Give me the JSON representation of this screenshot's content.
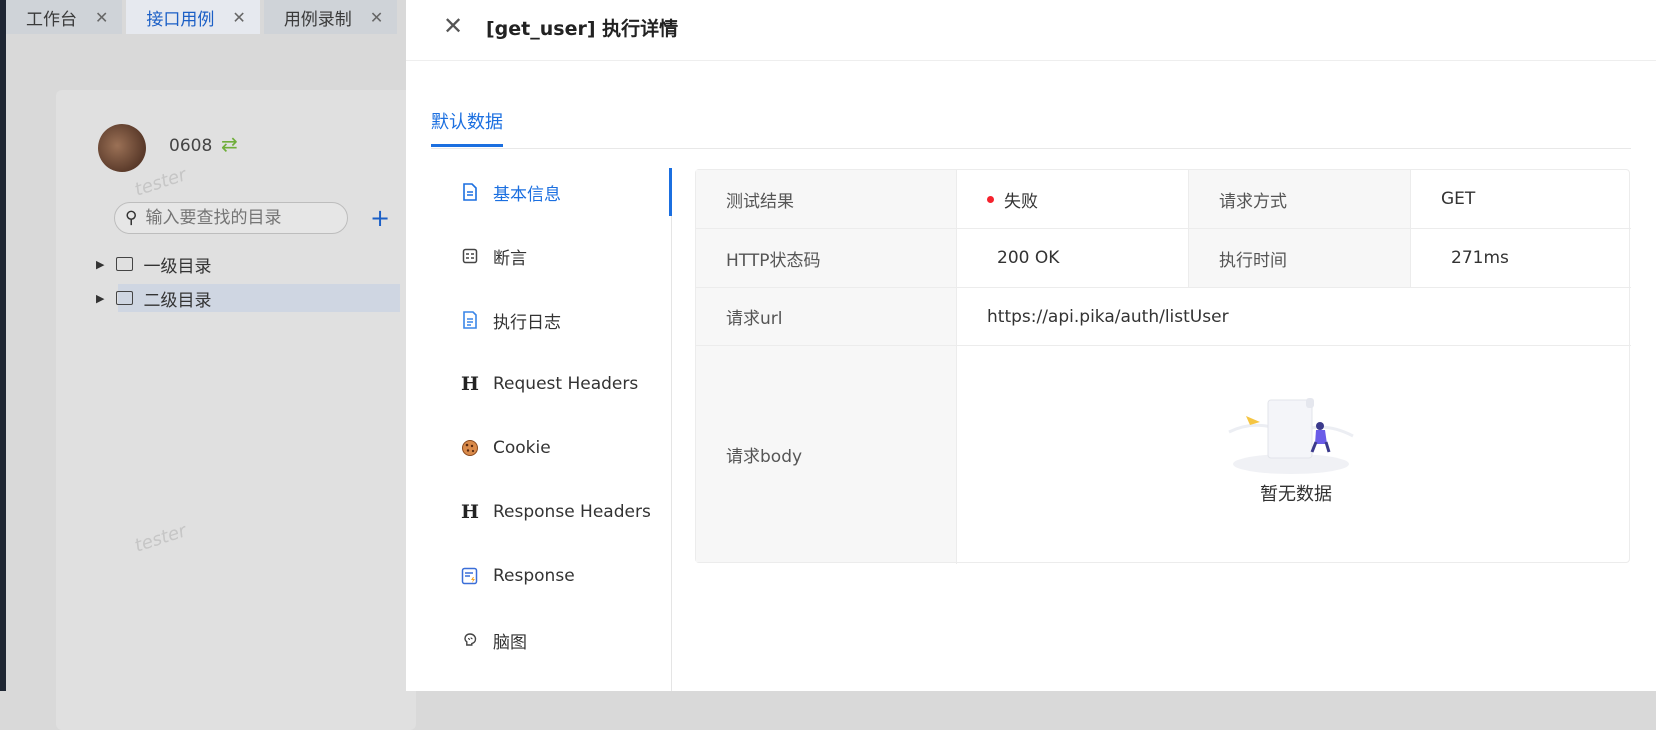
{
  "bg_app": {
    "tabs": [
      {
        "label": "工作台",
        "active": false
      },
      {
        "label": "接口用例",
        "active": true
      },
      {
        "label": "用例录制",
        "active": false
      }
    ],
    "user_name": "0608",
    "watermark": "tester",
    "search_placeholder": "输入要查找的目录",
    "tree": [
      {
        "label": "一级目录"
      },
      {
        "label": "二级目录",
        "selected": true
      }
    ]
  },
  "drawer": {
    "title": "[get_user] 执行详情",
    "tab": "默认数据",
    "nav": [
      {
        "label": "基本信息",
        "icon": "document-icon",
        "active": true
      },
      {
        "label": "断言",
        "icon": "assert-icon"
      },
      {
        "label": "执行日志",
        "icon": "log-icon"
      },
      {
        "label": "Request Headers",
        "icon": "heading-icon"
      },
      {
        "label": "Cookie",
        "icon": "cookie-icon"
      },
      {
        "label": "Response Headers",
        "icon": "heading-icon"
      },
      {
        "label": "Response",
        "icon": "response-icon"
      },
      {
        "label": "脑图",
        "icon": "brain-icon"
      }
    ],
    "info": {
      "test_result_label": "测试结果",
      "test_result": "失败",
      "method_label": "请求方式",
      "method": "GET",
      "status_label": "HTTP状态码",
      "status": "200 OK",
      "exec_time_label": "执行时间",
      "exec_time": "271ms",
      "url_label": "请求url",
      "url": "https://api.pika/auth/listUser",
      "body_label": "请求body",
      "empty_text": "暂无数据"
    }
  },
  "colors": {
    "accent": "#1b6fe0",
    "success": "#52c41a",
    "fail": "#f5222d"
  }
}
